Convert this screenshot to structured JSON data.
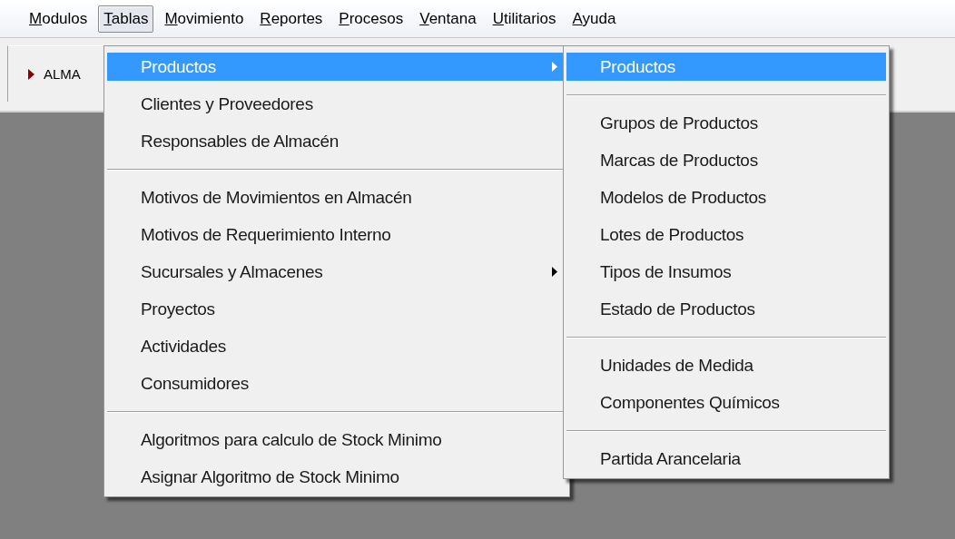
{
  "menu_bar": [
    {
      "label": "Modulos",
      "selected": false
    },
    {
      "label": "Tablas",
      "selected": true
    },
    {
      "label": "Movimiento",
      "selected": false
    },
    {
      "label": "Reportes",
      "selected": false
    },
    {
      "label": "Procesos",
      "selected": false
    },
    {
      "label": "Ventana",
      "selected": false
    },
    {
      "label": "Utilitarios",
      "selected": false
    },
    {
      "label": "Ayuda",
      "selected": false
    }
  ],
  "toolbar": {
    "panel_label": "ALMA"
  },
  "menu": {
    "items": [
      {
        "kind": "item",
        "label": "Productos",
        "selected": true,
        "submenu": true
      },
      {
        "kind": "item",
        "label": "Clientes y Proveedores",
        "selected": false,
        "submenu": false
      },
      {
        "kind": "item",
        "label": "Responsables de Almacén",
        "selected": false,
        "submenu": false
      },
      {
        "kind": "separator"
      },
      {
        "kind": "item",
        "label": "Motivos de Movimientos en Almacén",
        "selected": false,
        "submenu": false
      },
      {
        "kind": "item",
        "label": "Motivos de Requerimiento Interno",
        "selected": false,
        "submenu": false
      },
      {
        "kind": "item",
        "label": "Sucursales y Almacenes",
        "selected": false,
        "submenu": true
      },
      {
        "kind": "item",
        "label": "Proyectos",
        "selected": false,
        "submenu": false
      },
      {
        "kind": "item",
        "label": "Actividades",
        "selected": false,
        "submenu": false
      },
      {
        "kind": "item",
        "label": "Consumidores",
        "selected": false,
        "submenu": false
      },
      {
        "kind": "separator"
      },
      {
        "kind": "item",
        "label": "Algoritmos para calculo de Stock Minimo",
        "selected": false,
        "submenu": false
      },
      {
        "kind": "item",
        "label": "Asignar Algoritmo de Stock Minimo",
        "selected": false,
        "submenu": false
      }
    ]
  },
  "submenu": {
    "items": [
      {
        "kind": "item",
        "label": "Productos",
        "selected": true,
        "submenu": false
      },
      {
        "kind": "separator"
      },
      {
        "kind": "item",
        "label": "Grupos de Productos",
        "selected": false,
        "submenu": false
      },
      {
        "kind": "item",
        "label": "Marcas de Productos",
        "selected": false,
        "submenu": false
      },
      {
        "kind": "item",
        "label": "Modelos de Productos",
        "selected": false,
        "submenu": false
      },
      {
        "kind": "item",
        "label": "Lotes de Productos",
        "selected": false,
        "submenu": false
      },
      {
        "kind": "item",
        "label": "Tipos de Insumos",
        "selected": false,
        "submenu": false
      },
      {
        "kind": "item",
        "label": "Estado de Productos",
        "selected": false,
        "submenu": false
      },
      {
        "kind": "separator"
      },
      {
        "kind": "item",
        "label": "Unidades de Medida",
        "selected": false,
        "submenu": false
      },
      {
        "kind": "item",
        "label": "Componentes Químicos",
        "selected": false,
        "submenu": false
      },
      {
        "kind": "separator"
      },
      {
        "kind": "item",
        "label": "Partida Arancelaria",
        "selected": false,
        "submenu": false
      }
    ]
  }
}
